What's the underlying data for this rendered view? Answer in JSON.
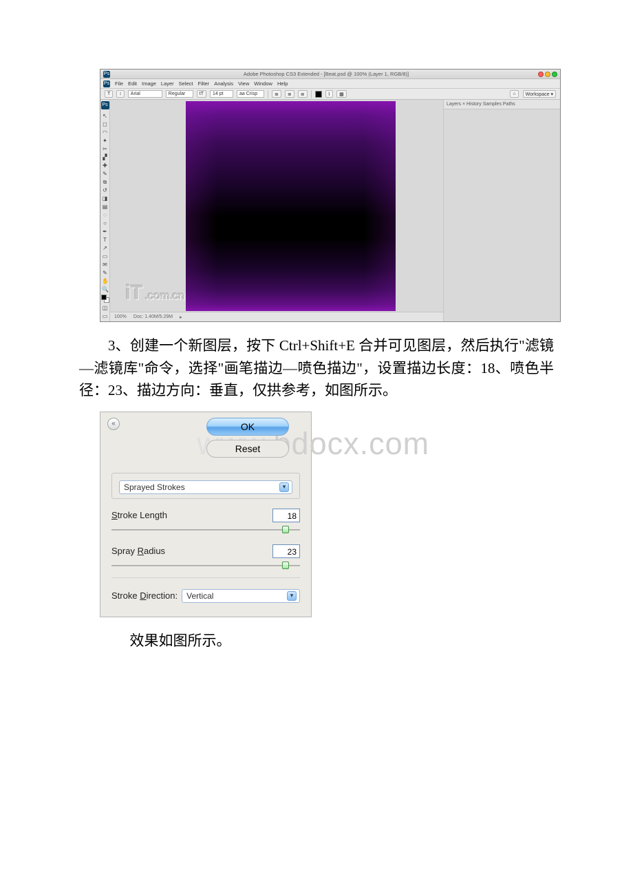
{
  "ps": {
    "title": "Adobe Photoshop CS3 Extended - [Beat.psd @ 100% (Layer 1, RGB/8)]",
    "menu": [
      "File",
      "Edit",
      "Image",
      "Layer",
      "Select",
      "Filter",
      "Analysis",
      "View",
      "Window",
      "Help"
    ],
    "options": {
      "tool": "T",
      "orient": "↕",
      "font": "Arial",
      "style": "Regular",
      "size": "14 pt",
      "aa": "aa Crisp",
      "workspace": "Workspace ▾"
    },
    "rightpanel": {
      "tabs": "Layers × History Samples Paths"
    },
    "status": {
      "zoom": "100%",
      "doc": "Doc: 1.40M/5.29M"
    },
    "watermark": {
      "brand": "iT",
      "domain": ".com.cn"
    }
  },
  "para1": "3、创建一个新图层，按下 Ctrl+Shift+E 合并可见图层，然后执行\"滤镜—滤镜库\"命令，选择\"画笔描边—喷色描边\"，设置描边长度：18、喷色半径：23、描边方向：垂直，仅拱参考，如图所示。",
  "filter": {
    "ok": "OK",
    "reset": "Reset",
    "name": "Sprayed Strokes",
    "stroke_length_label_pre": "S",
    "stroke_length_label": "troke Length",
    "stroke_length": "18",
    "spray_radius_label_pre": "Spray ",
    "spray_radius_label_u": "R",
    "spray_radius_label_post": "adius",
    "spray_radius": "23",
    "direction_label_pre": "Stroke ",
    "direction_label_u": "D",
    "direction_label_post": "irection:",
    "direction_value": "Vertical",
    "collapse": "«"
  },
  "watermark2": "bdocx.com",
  "watermark2_pre": "www.",
  "para2": "效果如图所示。"
}
